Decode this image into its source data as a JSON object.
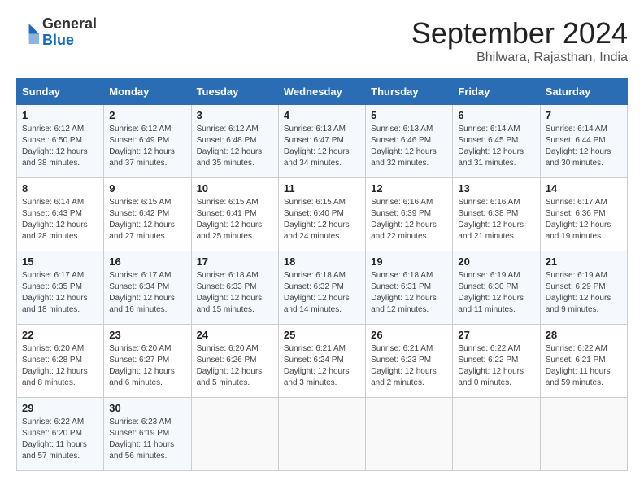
{
  "header": {
    "logo_general": "General",
    "logo_blue": "Blue",
    "month_title": "September 2024",
    "subtitle": "Bhilwara, Rajasthan, India"
  },
  "columns": [
    "Sunday",
    "Monday",
    "Tuesday",
    "Wednesday",
    "Thursday",
    "Friday",
    "Saturday"
  ],
  "weeks": [
    [
      {
        "day": "1",
        "sunrise": "6:12 AM",
        "sunset": "6:50 PM",
        "daylight": "12 hours and 38 minutes."
      },
      {
        "day": "2",
        "sunrise": "6:12 AM",
        "sunset": "6:49 PM",
        "daylight": "12 hours and 37 minutes."
      },
      {
        "day": "3",
        "sunrise": "6:12 AM",
        "sunset": "6:48 PM",
        "daylight": "12 hours and 35 minutes."
      },
      {
        "day": "4",
        "sunrise": "6:13 AM",
        "sunset": "6:47 PM",
        "daylight": "12 hours and 34 minutes."
      },
      {
        "day": "5",
        "sunrise": "6:13 AM",
        "sunset": "6:46 PM",
        "daylight": "12 hours and 32 minutes."
      },
      {
        "day": "6",
        "sunrise": "6:14 AM",
        "sunset": "6:45 PM",
        "daylight": "12 hours and 31 minutes."
      },
      {
        "day": "7",
        "sunrise": "6:14 AM",
        "sunset": "6:44 PM",
        "daylight": "12 hours and 30 minutes."
      }
    ],
    [
      {
        "day": "8",
        "sunrise": "6:14 AM",
        "sunset": "6:43 PM",
        "daylight": "12 hours and 28 minutes."
      },
      {
        "day": "9",
        "sunrise": "6:15 AM",
        "sunset": "6:42 PM",
        "daylight": "12 hours and 27 minutes."
      },
      {
        "day": "10",
        "sunrise": "6:15 AM",
        "sunset": "6:41 PM",
        "daylight": "12 hours and 25 minutes."
      },
      {
        "day": "11",
        "sunrise": "6:15 AM",
        "sunset": "6:40 PM",
        "daylight": "12 hours and 24 minutes."
      },
      {
        "day": "12",
        "sunrise": "6:16 AM",
        "sunset": "6:39 PM",
        "daylight": "12 hours and 22 minutes."
      },
      {
        "day": "13",
        "sunrise": "6:16 AM",
        "sunset": "6:38 PM",
        "daylight": "12 hours and 21 minutes."
      },
      {
        "day": "14",
        "sunrise": "6:17 AM",
        "sunset": "6:36 PM",
        "daylight": "12 hours and 19 minutes."
      }
    ],
    [
      {
        "day": "15",
        "sunrise": "6:17 AM",
        "sunset": "6:35 PM",
        "daylight": "12 hours and 18 minutes."
      },
      {
        "day": "16",
        "sunrise": "6:17 AM",
        "sunset": "6:34 PM",
        "daylight": "12 hours and 16 minutes."
      },
      {
        "day": "17",
        "sunrise": "6:18 AM",
        "sunset": "6:33 PM",
        "daylight": "12 hours and 15 minutes."
      },
      {
        "day": "18",
        "sunrise": "6:18 AM",
        "sunset": "6:32 PM",
        "daylight": "12 hours and 14 minutes."
      },
      {
        "day": "19",
        "sunrise": "6:18 AM",
        "sunset": "6:31 PM",
        "daylight": "12 hours and 12 minutes."
      },
      {
        "day": "20",
        "sunrise": "6:19 AM",
        "sunset": "6:30 PM",
        "daylight": "12 hours and 11 minutes."
      },
      {
        "day": "21",
        "sunrise": "6:19 AM",
        "sunset": "6:29 PM",
        "daylight": "12 hours and 9 minutes."
      }
    ],
    [
      {
        "day": "22",
        "sunrise": "6:20 AM",
        "sunset": "6:28 PM",
        "daylight": "12 hours and 8 minutes."
      },
      {
        "day": "23",
        "sunrise": "6:20 AM",
        "sunset": "6:27 PM",
        "daylight": "12 hours and 6 minutes."
      },
      {
        "day": "24",
        "sunrise": "6:20 AM",
        "sunset": "6:26 PM",
        "daylight": "12 hours and 5 minutes."
      },
      {
        "day": "25",
        "sunrise": "6:21 AM",
        "sunset": "6:24 PM",
        "daylight": "12 hours and 3 minutes."
      },
      {
        "day": "26",
        "sunrise": "6:21 AM",
        "sunset": "6:23 PM",
        "daylight": "12 hours and 2 minutes."
      },
      {
        "day": "27",
        "sunrise": "6:22 AM",
        "sunset": "6:22 PM",
        "daylight": "12 hours and 0 minutes."
      },
      {
        "day": "28",
        "sunrise": "6:22 AM",
        "sunset": "6:21 PM",
        "daylight": "11 hours and 59 minutes."
      }
    ],
    [
      {
        "day": "29",
        "sunrise": "6:22 AM",
        "sunset": "6:20 PM",
        "daylight": "11 hours and 57 minutes."
      },
      {
        "day": "30",
        "sunrise": "6:23 AM",
        "sunset": "6:19 PM",
        "daylight": "11 hours and 56 minutes."
      },
      null,
      null,
      null,
      null,
      null
    ]
  ]
}
